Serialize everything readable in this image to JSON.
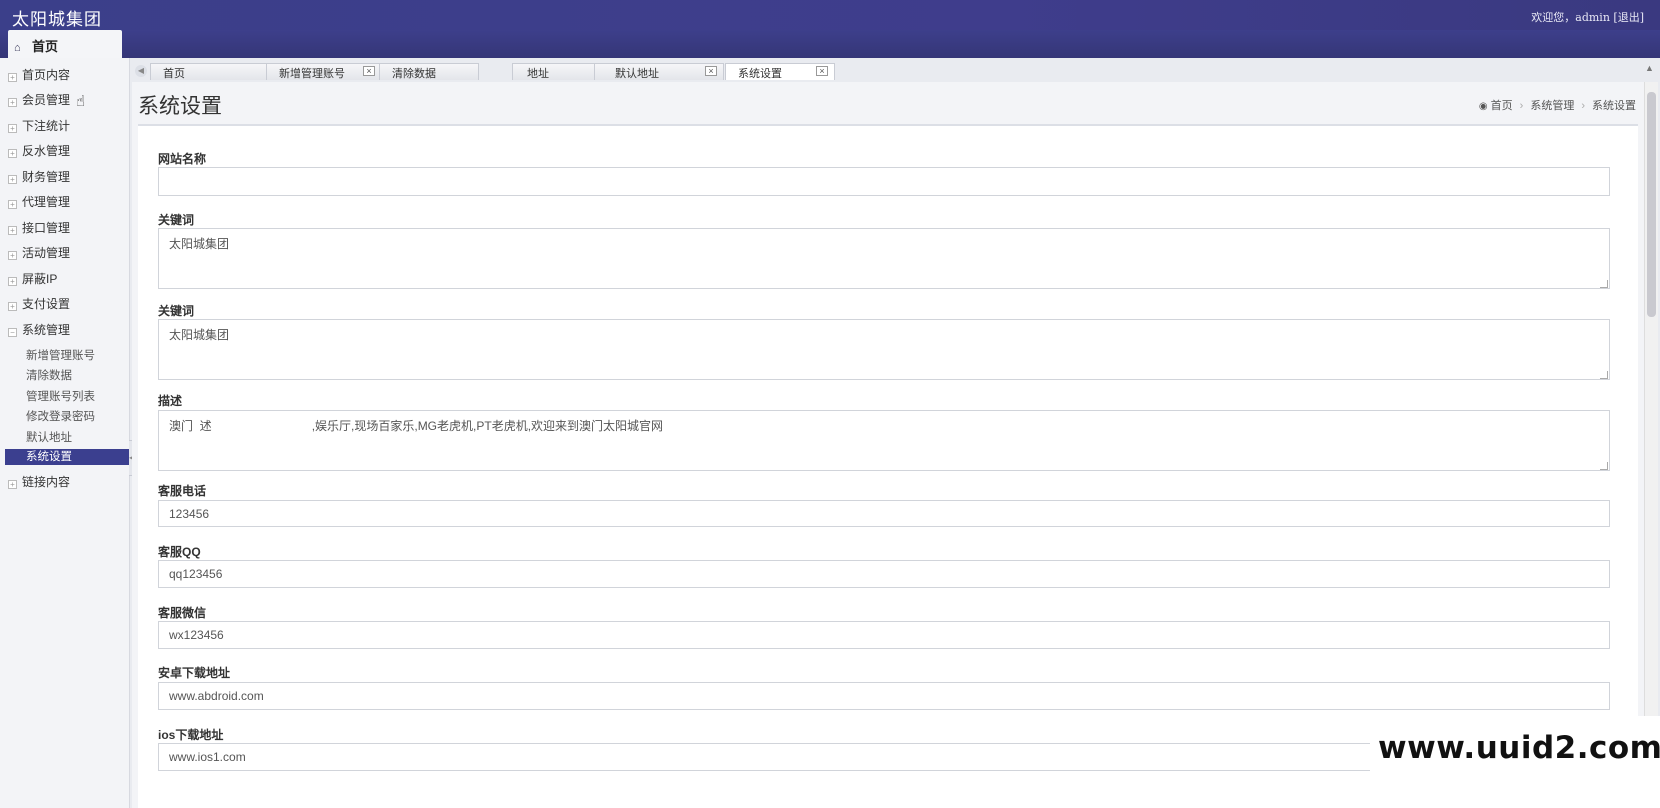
{
  "header": {
    "brand": "太阳城集团",
    "welcome": "欢迎您，admin",
    "logout": "[退出]"
  },
  "nav": {
    "home_tab": "首页",
    "home_icon": "home-icon"
  },
  "sidebar": {
    "items": [
      {
        "label": "首页内容"
      },
      {
        "label": "会员管理"
      },
      {
        "label": "下注统计"
      },
      {
        "label": "反水管理"
      },
      {
        "label": "财务管理"
      },
      {
        "label": "代理管理"
      },
      {
        "label": "接口管理"
      },
      {
        "label": "活动管理"
      },
      {
        "label": "屏蔽IP"
      },
      {
        "label": "支付设置"
      },
      {
        "label": "系统管理"
      }
    ],
    "sub_items": [
      {
        "label": "新增管理账号"
      },
      {
        "label": "清除数据"
      },
      {
        "label": "管理账号列表"
      },
      {
        "label": "修改登录密码"
      },
      {
        "label": "默认地址"
      },
      {
        "label": "系统设置",
        "active": true
      }
    ],
    "last_item": {
      "label": "链接内容"
    }
  },
  "tabs": [
    {
      "label": "首页"
    },
    {
      "label": "新增管理账号"
    },
    {
      "label": "清除数据"
    },
    {
      "label": "地址"
    },
    {
      "label": "默认地址"
    },
    {
      "label": "系统设置",
      "active": true
    }
  ],
  "page": {
    "title": "系统设置",
    "breadcrumb": [
      "首页",
      "系统管理",
      "系统设置"
    ]
  },
  "form": {
    "site_name": {
      "label": "网站名称",
      "value": ""
    },
    "keywords1": {
      "label": "关键词",
      "value": "太阳城集团"
    },
    "keywords2": {
      "label": "关键词",
      "value": "太阳城集团"
    },
    "description": {
      "label": "描述",
      "value": "澳门  述                              ,娱乐厅,现场百家乐,MG老虎机,PT老虎机,欢迎来到澳门太阳城官网"
    },
    "service_phone": {
      "label": "客服电话",
      "value": "123456"
    },
    "service_qq": {
      "label": "客服QQ",
      "value": "qq123456"
    },
    "service_wechat": {
      "label": "客服微信",
      "value": "wx123456"
    },
    "android_url": {
      "label": "安卓下载地址",
      "value": "www.abdroid.com"
    },
    "ios_url": {
      "label": "ios下载地址",
      "value": "www.ios1.com"
    }
  },
  "watermark": "www.uuid2.com",
  "colors": {
    "header": "#3b3f8a",
    "active_item": "#3b3f8f"
  }
}
